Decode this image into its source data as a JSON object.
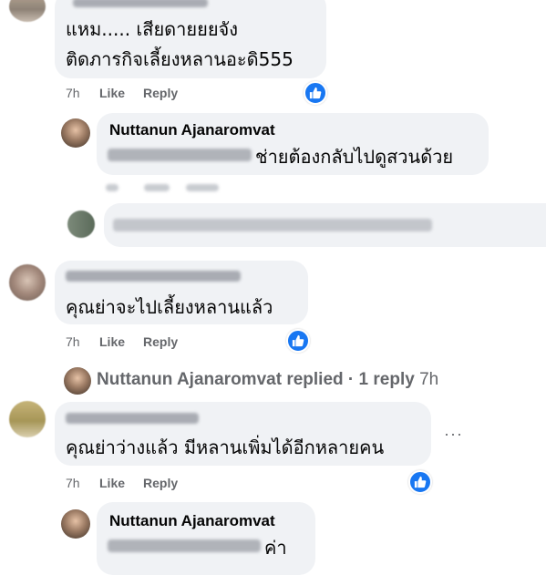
{
  "comments": [
    {
      "id": "c1",
      "text_line1": "แหม..... เสียดายยยจัง",
      "text_line2": "ติดภารกิจเลี้ยงหลานอะดิ555",
      "time": "7h",
      "like_label": "Like",
      "reply_label": "Reply"
    },
    {
      "id": "c1-reply",
      "author": "Nuttanun Ajanaromvat",
      "text_suffix": "ช่ายต้องกลับไปดูสวนด้วย"
    },
    {
      "id": "c2",
      "text": "คุณย่าจะไปเลี้ยงหลานแล้ว",
      "time": "7h",
      "like_label": "Like",
      "reply_label": "Reply",
      "replied_summary": {
        "author": "Nuttanun Ajanaromvat",
        "action": "replied",
        "separator": "·",
        "count_label": "1 reply",
        "time": "7h"
      }
    },
    {
      "id": "c3",
      "text": "คุณย่าว่างแล้ว มีหลานเพิ่มได้อีกหลายคน",
      "time": "7h",
      "like_label": "Like",
      "reply_label": "Reply",
      "more_label": "···"
    },
    {
      "id": "c3-reply",
      "author": "Nuttanun Ajanaromvat",
      "text_suffix": "ค่า"
    }
  ],
  "colors": {
    "bubble": "#f0f2f5",
    "meta": "#65676b",
    "like_blue": "#1877f2",
    "blur_gray": "#b9bcc2"
  },
  "icons": {
    "like_badge": "thumbs-up-icon",
    "more": "more-options-icon"
  }
}
